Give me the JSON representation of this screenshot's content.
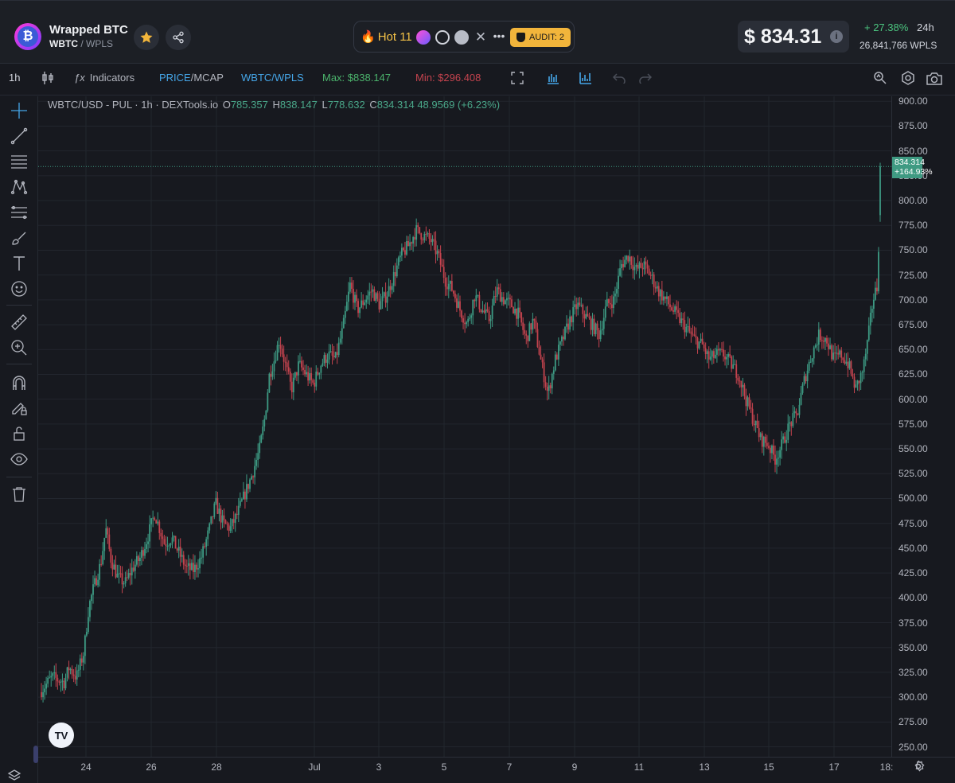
{
  "header": {
    "logo_letter": "₿",
    "token_name": "Wrapped BTC",
    "base": "WBTC",
    "quote": "/ WPLS",
    "hot_label": "Hot 11",
    "audit_label": "AUDIT: 2",
    "price": "$ 834.31",
    "price_info": "i",
    "change": "+ 27.38%",
    "period": "24h",
    "volume": "26,841,766  WPLS"
  },
  "toolbar": {
    "interval": "1h",
    "indicators_label": "Indicators",
    "price_label": "PRICE",
    "mcap_label": "/MCAP",
    "pair_label": "WBTC/WPLS",
    "max_label": "Max: $838.147",
    "min_label": "Min: $296.408"
  },
  "legend": {
    "symbol": "WBTC/USD - PUL · 1h · DEXTools.io",
    "o_label": "O",
    "o": "785.357",
    "h_label": "H",
    "h": "838.147",
    "l_label": "L",
    "l": "778.632",
    "c_label": "C",
    "c": "834.314",
    "change": "48.9569 (+6.23%)"
  },
  "last_price": {
    "value": "834.314",
    "change": "+164.93%"
  },
  "chart_data": {
    "type": "candlestick",
    "title": "WBTC/USD - PUL · 1h · DEXTools.io",
    "ylim": [
      240,
      905
    ],
    "y_ticks": [
      "900.00",
      "875.00",
      "850.00",
      "825.00",
      "800.00",
      "775.00",
      "750.00",
      "725.00",
      "700.00",
      "675.00",
      "650.00",
      "625.00",
      "600.00",
      "575.00",
      "550.00",
      "525.00",
      "500.00",
      "475.00",
      "450.00",
      "425.00",
      "400.00",
      "375.00",
      "350.00",
      "325.00",
      "300.00",
      "275.00",
      "250.00"
    ],
    "x_ticks": [
      "24",
      "26",
      "28",
      "Jul",
      "3",
      "5",
      "7",
      "9",
      "11",
      "13",
      "15",
      "17",
      "18:"
    ],
    "up_color": "#3d9a83",
    "down_color": "#c4434e",
    "price_path": [
      [
        0,
        305
      ],
      [
        5,
        320
      ],
      [
        10,
        315
      ],
      [
        12,
        330
      ],
      [
        15,
        320
      ],
      [
        18,
        345
      ],
      [
        20,
        390
      ],
      [
        22,
        410
      ],
      [
        25,
        435
      ],
      [
        27,
        470
      ],
      [
        29,
        440
      ],
      [
        32,
        420
      ],
      [
        35,
        415
      ],
      [
        38,
        430
      ],
      [
        41,
        440
      ],
      [
        44,
        460
      ],
      [
        47,
        485
      ],
      [
        49,
        470
      ],
      [
        51,
        455
      ],
      [
        54,
        460
      ],
      [
        57,
        445
      ],
      [
        60,
        430
      ],
      [
        63,
        428
      ],
      [
        66,
        440
      ],
      [
        69,
        465
      ],
      [
        72,
        495
      ],
      [
        75,
        475
      ],
      [
        78,
        470
      ],
      [
        81,
        485
      ],
      [
        84,
        505
      ],
      [
        87,
        525
      ],
      [
        90,
        550
      ],
      [
        92,
        580
      ],
      [
        94,
        625
      ],
      [
        96,
        640
      ],
      [
        98,
        660
      ],
      [
        100,
        640
      ],
      [
        103,
        610
      ],
      [
        106,
        635
      ],
      [
        109,
        625
      ],
      [
        112,
        615
      ],
      [
        115,
        635
      ],
      [
        118,
        645
      ],
      [
        121,
        640
      ],
      [
        124,
        670
      ],
      [
        127,
        715
      ],
      [
        130,
        690
      ],
      [
        133,
        700
      ],
      [
        136,
        710
      ],
      [
        139,
        695
      ],
      [
        142,
        705
      ],
      [
        145,
        725
      ],
      [
        148,
        745
      ],
      [
        151,
        755
      ],
      [
        154,
        770
      ],
      [
        157,
        765
      ],
      [
        160,
        760
      ],
      [
        163,
        745
      ],
      [
        166,
        720
      ],
      [
        169,
        710
      ],
      [
        172,
        690
      ],
      [
        175,
        675
      ],
      [
        178,
        705
      ],
      [
        181,
        690
      ],
      [
        184,
        680
      ],
      [
        187,
        710
      ],
      [
        190,
        700
      ],
      [
        193,
        695
      ],
      [
        196,
        685
      ],
      [
        199,
        660
      ],
      [
        202,
        680
      ],
      [
        205,
        640
      ],
      [
        208,
        605
      ],
      [
        211,
        640
      ],
      [
        214,
        660
      ],
      [
        217,
        680
      ],
      [
        220,
        695
      ],
      [
        223,
        685
      ],
      [
        226,
        675
      ],
      [
        229,
        665
      ],
      [
        232,
        695
      ],
      [
        235,
        700
      ],
      [
        238,
        735
      ],
      [
        241,
        745
      ],
      [
        244,
        730
      ],
      [
        247,
        735
      ],
      [
        250,
        725
      ],
      [
        253,
        710
      ],
      [
        256,
        700
      ],
      [
        259,
        690
      ],
      [
        262,
        680
      ],
      [
        265,
        670
      ],
      [
        268,
        660
      ],
      [
        271,
        655
      ],
      [
        274,
        640
      ],
      [
        277,
        645
      ],
      [
        280,
        645
      ],
      [
        283,
        635
      ],
      [
        286,
        625
      ],
      [
        289,
        600
      ],
      [
        292,
        580
      ],
      [
        295,
        560
      ],
      [
        298,
        555
      ],
      [
        301,
        540
      ],
      [
        304,
        555
      ],
      [
        307,
        575
      ],
      [
        310,
        585
      ],
      [
        313,
        620
      ],
      [
        316,
        645
      ],
      [
        319,
        665
      ],
      [
        322,
        660
      ],
      [
        325,
        640
      ],
      [
        328,
        645
      ],
      [
        331,
        635
      ],
      [
        334,
        610
      ],
      [
        337,
        630
      ],
      [
        339,
        660
      ],
      [
        341,
        700
      ],
      [
        343,
        715
      ],
      [
        344,
        834.3
      ]
    ],
    "series_range": [
      0,
      344
    ],
    "last_price": 834.314,
    "open": 785.357,
    "high": 838.147,
    "low": 778.632,
    "close": 834.314,
    "change": "48.9569 (+6.23%)",
    "max": 838.147,
    "min": 296.408,
    "grid": true
  }
}
